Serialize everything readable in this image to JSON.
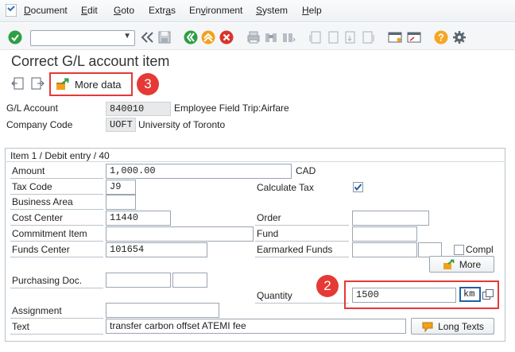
{
  "menu": {
    "items": [
      "Document",
      "Edit",
      "Goto",
      "Extras",
      "Environment",
      "System",
      "Help"
    ],
    "underlined": [
      "D",
      "E",
      "G",
      "a",
      "v",
      "S",
      "H"
    ]
  },
  "toolbar": {
    "command_field_value": "",
    "icons": [
      "enter-icon",
      "back-nav-icon",
      "save-icon",
      "back-icon",
      "exit-icon",
      "cancel-icon",
      "print-icon",
      "find-icon",
      "find-next-icon",
      "first-page-icon",
      "previous-page-icon",
      "next-page-icon",
      "last-page-icon",
      "create-session-icon",
      "shortcut-icon",
      "help-icon",
      "settings-icon"
    ]
  },
  "page": {
    "title": "Correct G/L account item"
  },
  "app_toolbar": {
    "more_data_label": "More data"
  },
  "header": {
    "gl_account_label": "G/L Account",
    "gl_account_value": "840010",
    "gl_account_text": "Employee Field Trip:Airfare",
    "company_code_label": "Company Code",
    "company_code_value": "UOFT",
    "company_code_text": "University of Toronto"
  },
  "item": {
    "group_title": "Item 1 / Debit entry / 40",
    "amount_label": "Amount",
    "amount_value": "1,000.00",
    "currency": "CAD",
    "tax_code_label": "Tax Code",
    "tax_code_value": "J9",
    "calculate_tax_label": "Calculate Tax",
    "calculate_tax_checked": true,
    "business_area_label": "Business Area",
    "business_area_value": "",
    "cost_center_label": "Cost Center",
    "cost_center_value": "11440",
    "order_label": "Order",
    "order_value": "",
    "commitment_item_label": "Commitment Item",
    "commitment_item_value": "",
    "fund_label": "Fund",
    "fund_value": "",
    "funds_center_label": "Funds Center",
    "funds_center_value": "101654",
    "earmarked_funds_label": "Earmarked Funds",
    "earmarked_funds_value": "",
    "earmarked_funds_item": "",
    "compl_label": "Compl",
    "compl_checked": false,
    "more_button_label": "More",
    "purchasing_doc_label": "Purchasing Doc.",
    "purchasing_doc_value": "",
    "purchasing_doc_item": "",
    "quantity_label": "Quantity",
    "quantity_value": "1500",
    "unit_value": "km",
    "assignment_label": "Assignment",
    "assignment_value": "",
    "text_label": "Text",
    "text_value": "transfer carbon offset ATEMI fee",
    "long_texts_label": "Long Texts"
  },
  "annotations": {
    "step_more_data": "3",
    "step_quantity": "2"
  },
  "colors": {
    "annotation_red": "#e53935",
    "enter_green": "#2e9e44",
    "exit_orange": "#f0a21c",
    "cancel_red": "#d9342b",
    "help_orange": "#f5a623"
  }
}
